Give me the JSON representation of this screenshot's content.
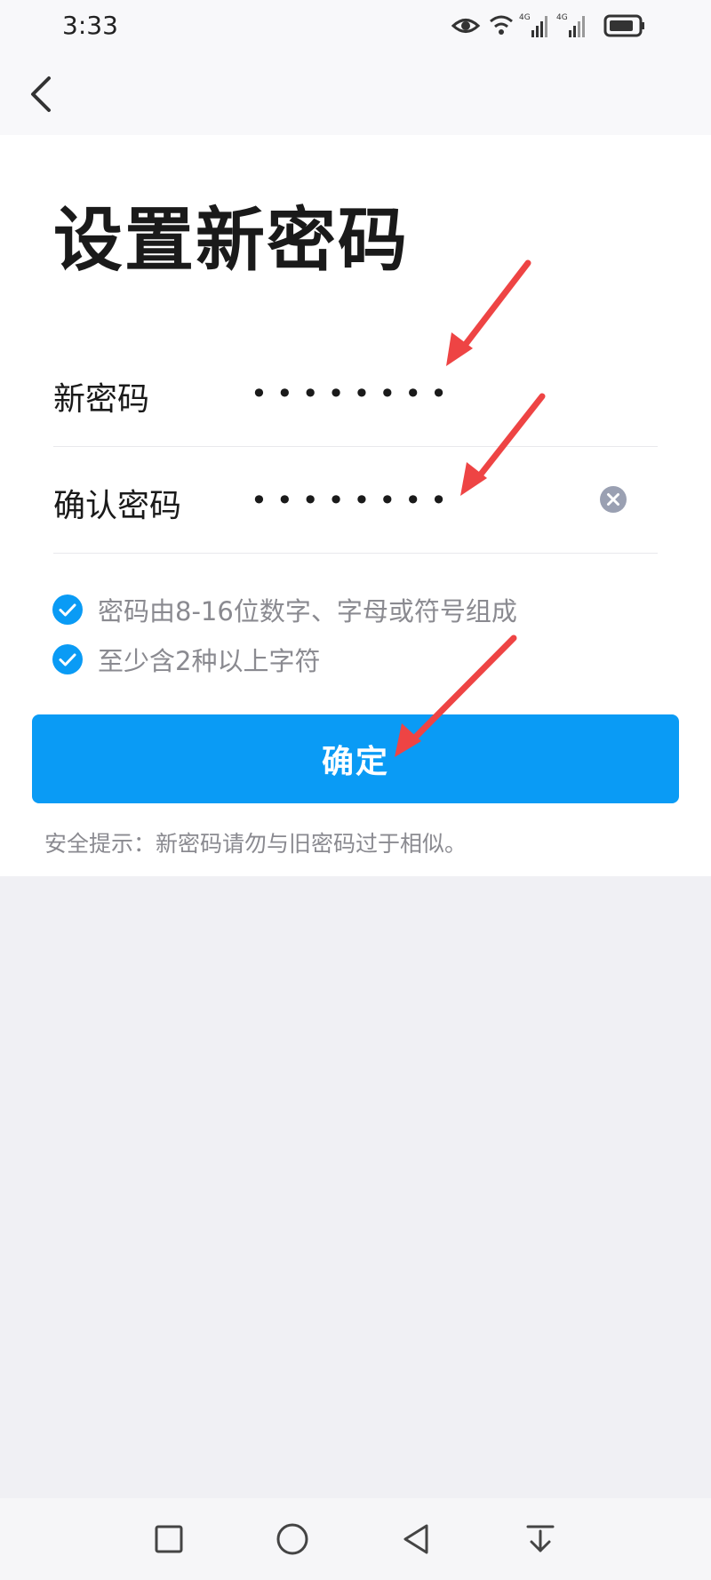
{
  "status_bar": {
    "time": "3:33",
    "network_1": "4G",
    "network_2": "4G",
    "icons": [
      "eye-icon",
      "wifi-icon",
      "signal-icon",
      "signal-icon",
      "battery-icon"
    ]
  },
  "header": {
    "back_icon": "chevron-left-icon"
  },
  "page": {
    "title": "设置新密码"
  },
  "form": {
    "new_password": {
      "label": "新密码",
      "value": "••••••••"
    },
    "confirm_password": {
      "label": "确认密码",
      "value": "••••••••",
      "clear_icon": "close-circle-icon"
    }
  },
  "rules": [
    {
      "text": "密码由8-16位数字、字母或符号组成",
      "checked": true
    },
    {
      "text": "至少含2种以上字符",
      "checked": true
    }
  ],
  "confirm_button": {
    "label": "确定"
  },
  "tip": {
    "text": "安全提示：新密码请勿与旧密码过于相似。"
  },
  "nav_bar": {
    "buttons": [
      "square-icon",
      "circle-icon",
      "triangle-back-icon",
      "notification-down-icon"
    ]
  },
  "colors": {
    "primary": "#0a9bf5",
    "annotation_arrow": "#ee4444"
  }
}
